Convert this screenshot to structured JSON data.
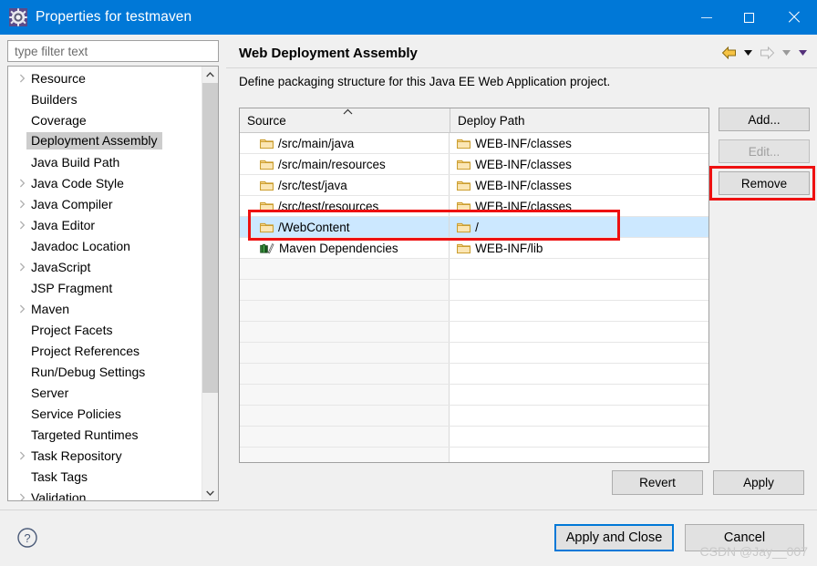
{
  "window": {
    "title": "Properties for testmaven",
    "icon": "eclipse-properties-gear-icon",
    "controls": {
      "minimize": "minimize-button",
      "maximize": "maximize-button",
      "close": "close-button"
    },
    "accent_color": "#0078d7"
  },
  "sidebar": {
    "filter": {
      "value": "",
      "placeholder": "type filter text"
    },
    "items": [
      {
        "label": "Resource",
        "expandable": true,
        "selected": false
      },
      {
        "label": "Builders",
        "expandable": false,
        "selected": false
      },
      {
        "label": "Coverage",
        "expandable": false,
        "selected": false
      },
      {
        "label": "Deployment Assembly",
        "expandable": false,
        "selected": true
      },
      {
        "label": "Java Build Path",
        "expandable": false,
        "selected": false
      },
      {
        "label": "Java Code Style",
        "expandable": true,
        "selected": false
      },
      {
        "label": "Java Compiler",
        "expandable": true,
        "selected": false
      },
      {
        "label": "Java Editor",
        "expandable": true,
        "selected": false
      },
      {
        "label": "Javadoc Location",
        "expandable": false,
        "selected": false
      },
      {
        "label": "JavaScript",
        "expandable": true,
        "selected": false
      },
      {
        "label": "JSP Fragment",
        "expandable": false,
        "selected": false
      },
      {
        "label": "Maven",
        "expandable": true,
        "selected": false
      },
      {
        "label": "Project Facets",
        "expandable": false,
        "selected": false
      },
      {
        "label": "Project References",
        "expandable": false,
        "selected": false
      },
      {
        "label": "Run/Debug Settings",
        "expandable": false,
        "selected": false
      },
      {
        "label": "Server",
        "expandable": false,
        "selected": false
      },
      {
        "label": "Service Policies",
        "expandable": false,
        "selected": false
      },
      {
        "label": "Targeted Runtimes",
        "expandable": false,
        "selected": false
      },
      {
        "label": "Task Repository",
        "expandable": true,
        "selected": false
      },
      {
        "label": "Task Tags",
        "expandable": false,
        "selected": false
      },
      {
        "label": "Validation",
        "expandable": true,
        "selected": false
      }
    ],
    "scrollbar": {
      "up": "scroll-up-arrow",
      "down": "scroll-down-arrow"
    }
  },
  "page": {
    "title": "Web Deployment Assembly",
    "description": "Define packaging structure for this Java EE Web Application project.",
    "nav": {
      "back": "back-arrow-icon",
      "back_menu": "back-dropdown-caret",
      "forward": "forward-arrow-icon",
      "forward_menu": "forward-dropdown-caret",
      "view_menu": "view-menu-caret"
    }
  },
  "table": {
    "columns": [
      {
        "label": "Source",
        "sorted": "asc"
      },
      {
        "label": "Deploy Path",
        "sorted": "none"
      }
    ],
    "rows": [
      {
        "source": "/src/main/java",
        "source_icon": "folder-icon",
        "deploy": "WEB-INF/classes",
        "deploy_icon": "folder-icon",
        "selected": false
      },
      {
        "source": "/src/main/resources",
        "source_icon": "folder-icon",
        "deploy": "WEB-INF/classes",
        "deploy_icon": "folder-icon",
        "selected": false
      },
      {
        "source": "/src/test/java",
        "source_icon": "folder-icon",
        "deploy": "WEB-INF/classes",
        "deploy_icon": "folder-icon",
        "selected": false
      },
      {
        "source": "/src/test/resources",
        "source_icon": "folder-icon",
        "deploy": "WEB-INF/classes",
        "deploy_icon": "folder-icon",
        "selected": false
      },
      {
        "source": "/WebContent",
        "source_icon": "folder-icon",
        "deploy": "/",
        "deploy_icon": "folder-icon",
        "selected": true
      },
      {
        "source": "Maven Dependencies",
        "source_icon": "library-icon",
        "deploy": "WEB-INF/lib",
        "deploy_icon": "folder-icon",
        "selected": false
      }
    ],
    "empty_row_count": 11
  },
  "side_buttons": [
    {
      "label": "Add...",
      "enabled": true,
      "highlighted": false
    },
    {
      "label": "Edit...",
      "enabled": false,
      "highlighted": false
    },
    {
      "label": "Remove",
      "enabled": true,
      "highlighted": true
    }
  ],
  "page_buttons": [
    {
      "label": "Revert",
      "enabled": true
    },
    {
      "label": "Apply",
      "enabled": true
    }
  ],
  "footer": {
    "help_icon": "help-question-icon",
    "buttons": [
      {
        "label": "Apply and Close",
        "focused": true
      },
      {
        "label": "Cancel",
        "focused": false
      }
    ]
  },
  "watermark": "CSDN @Jay__007",
  "annotations": {
    "remove_highlight_color": "#ee1111",
    "row_highlight_color": "#ee1111"
  }
}
